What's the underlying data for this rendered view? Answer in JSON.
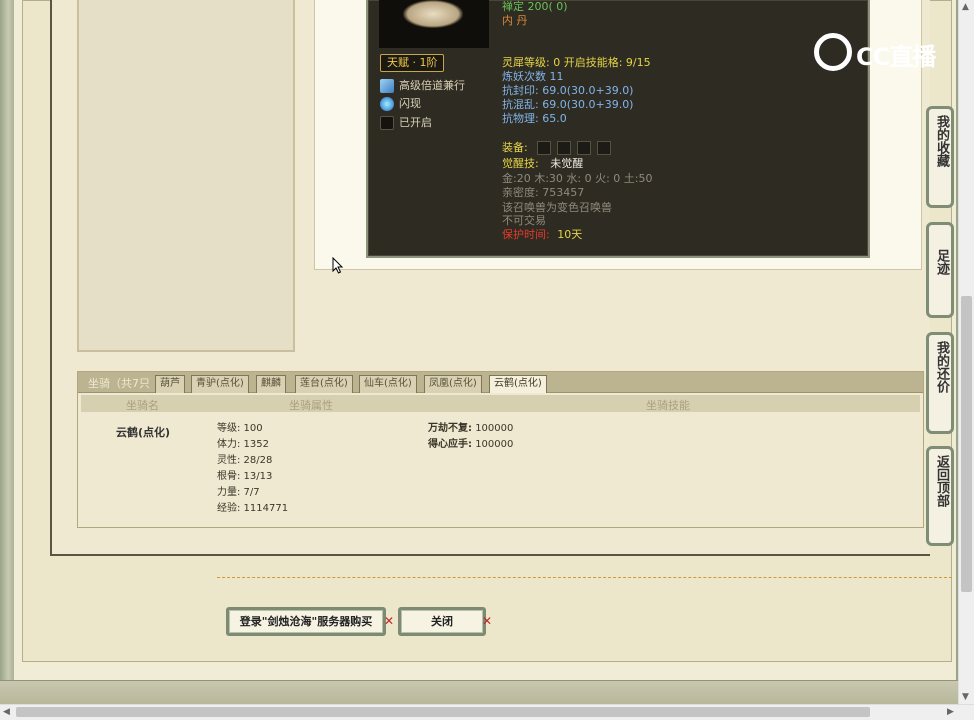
{
  "pet": {
    "top_line_1": "禅定 200( 0)",
    "top_line_2": "内  丹",
    "talent_badge": "天赋 · 1阶",
    "skills": [
      {
        "label": "高级倍道兼行",
        "icon": "boots-icon"
      },
      {
        "label": "闪现",
        "icon": "flash-icon"
      },
      {
        "label": "已开启",
        "icon": "locked-slot-icon"
      }
    ],
    "spirit_level": "灵犀等级:  0  开启技能格:  9/15",
    "demon_count": "炼妖次数 11",
    "resist_seal": "抗封印: 69.0(30.0+39.0)",
    "resist_chaos": "抗混乱: 69.0(30.0+39.0)",
    "resist_physical": "抗物理: 65.0",
    "equip_label": "装备:",
    "awaken_label": "觉醒技:",
    "awaken_value": "未觉醒",
    "elements": "金:20 木:30 水: 0 火: 0 土:50",
    "intimacy": "亲密度: 753457",
    "note_1": "该召唤兽为变色召唤兽",
    "note_2": "不可交易",
    "protect_label": "保护时间:",
    "protect_value": "10天"
  },
  "mount": {
    "title": "坐骑（共7只",
    "tabs": [
      "葫芦",
      "青驴(点化)",
      "麒麟",
      "莲台(点化)",
      "仙车(点化)",
      "凤凰(点化)",
      "云鹤(点化)"
    ],
    "active_tab": 6,
    "headers": [
      "坐骑名",
      "坐骑属性",
      "坐骑技能"
    ],
    "name": "云鹤(点化)",
    "stats": [
      "等级:   100",
      "体力:   1352",
      "灵性:   28/28",
      "根骨:   13/13",
      "力量:   7/7",
      "经验:   1114771"
    ],
    "skills": [
      {
        "name": "万劫不复:",
        "value": "100000"
      },
      {
        "name": "得心应手:",
        "value": "100000"
      }
    ]
  },
  "buttons": {
    "login_buy": "登录\"剑烛沧海\"服务器购买",
    "close": "关闭"
  },
  "side_buttons": {
    "favorites": "我的收藏",
    "footprints": "足迹",
    "bargain": "我的还价",
    "back_to_top": "返回顶部"
  },
  "watermark": "CC直播"
}
